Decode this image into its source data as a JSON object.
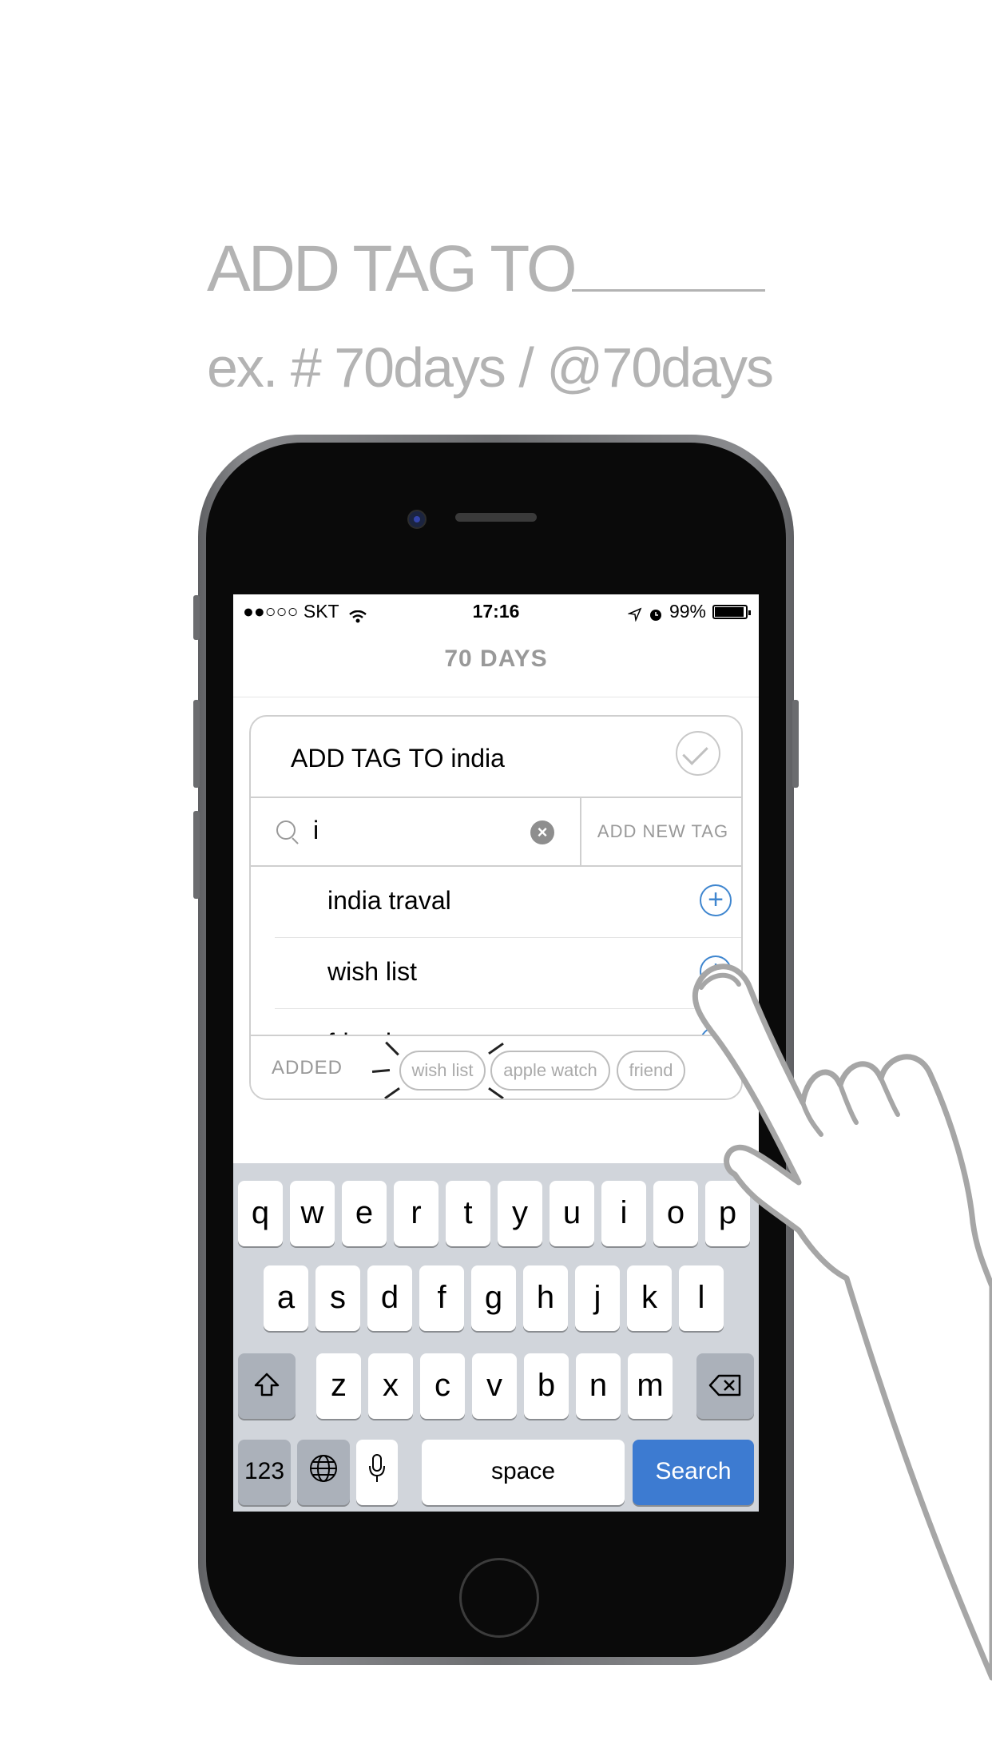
{
  "promo": {
    "headline": "ADD TAG TO",
    "subline": "ex. # 70days / @70days"
  },
  "status_bar": {
    "carrier": "●●○○○ SKT",
    "wifi_icon": "wifi-icon",
    "time": "17:16",
    "battery": "99%"
  },
  "nav": {
    "title": "70 DAYS"
  },
  "card": {
    "title": "ADD TAG TO india",
    "search_value": "i",
    "add_new_tag": "ADD NEW TAG",
    "tags": [
      {
        "label": "india traval"
      },
      {
        "label": "wish list"
      },
      {
        "label": "friend"
      }
    ],
    "added_label": "ADDED",
    "added_chips": [
      "wish list",
      "apple watch",
      "friend"
    ]
  },
  "keyboard": {
    "row1": [
      "q",
      "w",
      "e",
      "r",
      "t",
      "y",
      "u",
      "i",
      "o",
      "p"
    ],
    "row2": [
      "a",
      "s",
      "d",
      "f",
      "g",
      "h",
      "j",
      "k",
      "l"
    ],
    "row3": [
      "z",
      "x",
      "c",
      "v",
      "b",
      "n",
      "m"
    ],
    "num_key": "123",
    "space_key": "space",
    "search_key": "Search"
  },
  "colors": {
    "accent": "#3f86cf",
    "search_key": "#3d7bd1",
    "promo_text": "#b3b3b3"
  }
}
